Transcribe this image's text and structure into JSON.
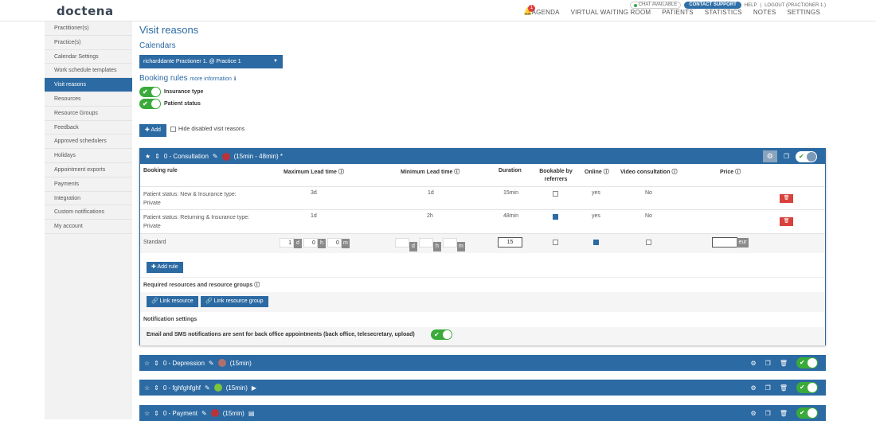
{
  "brand": {
    "logo": "doctena"
  },
  "top": {
    "chat": "CHAT AVAILABLE",
    "support": "CONTACT SUPPORT",
    "help": "HELP",
    "logout": "LOGOUT (PRACTIONER 1.)",
    "notif_count": "1",
    "nav": [
      "AGENDA",
      "VIRTUAL WAITING ROOM",
      "PATIENTS",
      "STATISTICS",
      "NOTES",
      "SETTINGS"
    ]
  },
  "sidebar": {
    "items": [
      "Practitioner(s)",
      "Practice(s)",
      "Calendar Settings",
      "Work schedule templates",
      "Visit reasons",
      "Resources",
      "Resource Groups",
      "Feedback",
      "Approved schedulers",
      "Holidays",
      "Appointment exports",
      "Payments",
      "Integration",
      "Custom notifications",
      "My account"
    ],
    "active_index": 4
  },
  "page": {
    "title": "Visit reasons",
    "calendars_label": "Calendars",
    "calendar_value": "richarddante Practioner 1. @ Practice 1",
    "booking_rules": "Booking rules",
    "more_info": "more information",
    "toggle1": "Insurance type",
    "toggle2": "Patient status",
    "add": "Add",
    "hide_disabled": "Hide disabled visit reasons"
  },
  "panel": {
    "title": "0 - Consultation",
    "duration": "(15min - 48min) *",
    "dot_color": "#b8333a",
    "headers": {
      "rule": "Booking rule",
      "max": "Maximum Lead time",
      "min": "Minimum Lead time",
      "duration": "Duration",
      "bookable": "Bookable by referrers",
      "online": "Online",
      "video": "Video consultation",
      "price": "Price"
    },
    "rows": [
      {
        "rule": "Patient status: New & Insurance type: Private",
        "max": "3d",
        "min": "1d",
        "duration": "15min",
        "bookable": false,
        "online": "yes",
        "video": "No"
      },
      {
        "rule": "Patient status: Returning & Insurance type: Private",
        "max": "1d",
        "min": "2h",
        "duration": "48min",
        "bookable": true,
        "online": "yes",
        "video": "No"
      }
    ],
    "standard": {
      "label": "Standard",
      "max_d": "1",
      "max_h": "0",
      "max_m": "0",
      "unit_d": "d",
      "unit_h": "h",
      "unit_m": "m",
      "duration": "15",
      "currency": "eur",
      "online": true,
      "bookable": false,
      "video": false
    },
    "add_rule": "Add rule",
    "resources_title": "Required resources and resource groups",
    "link_resource": "Link resource",
    "link_group": "Link resource group",
    "notif_title": "Notification settings",
    "notif_text": "Email and SMS notifications are sent for back office appointments (back office, telesecretary, upload)"
  },
  "reasons": [
    {
      "title": "0 - Depression",
      "dot_color": "#b07070",
      "duration": "(15min)",
      "icon": "pencil-icon"
    },
    {
      "title": "0 - fghfghfghf",
      "dot_color": "#7dc63b",
      "duration": "(15min)",
      "icon": "video-icon"
    },
    {
      "title": "0 - Payment",
      "dot_color": "#b8333a",
      "duration": "(15min)",
      "icon": "card-icon"
    }
  ]
}
